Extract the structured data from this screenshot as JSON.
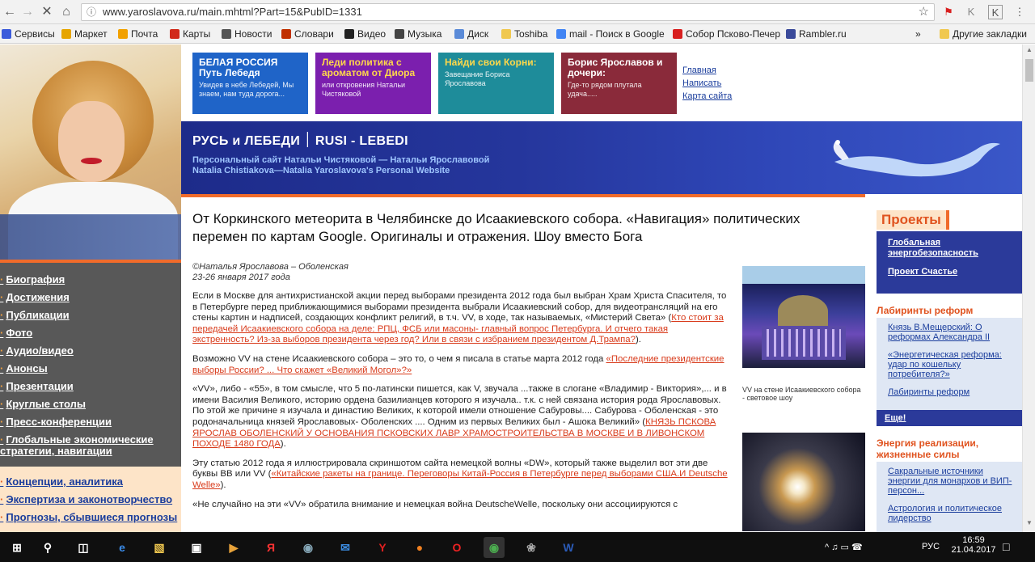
{
  "browser": {
    "url": "www.yaroslavova.ru/main.mhtml?Part=15&PubID=1331",
    "bookmarks": [
      {
        "label": "Сервисы",
        "color": "#3b5bdb"
      },
      {
        "label": "Маркет",
        "color": "#e6a500"
      },
      {
        "label": "Почта",
        "color": "#f2a100"
      },
      {
        "label": "Карты",
        "color": "#d12a1a"
      },
      {
        "label": "Новости",
        "color": "#555555"
      },
      {
        "label": "Словари",
        "color": "#c03000"
      },
      {
        "label": "Видео",
        "color": "#222222"
      },
      {
        "label": "Музыка",
        "color": "#444444"
      },
      {
        "label": "Диск",
        "color": "#5b8bd8"
      },
      {
        "label": "Toshiba",
        "color": "#f0c850"
      },
      {
        "label": "mail - Поиск в Google",
        "color": "#4285f4"
      },
      {
        "label": "Собор Псково-Печер",
        "color": "#d81f1f"
      },
      {
        "label": "Rambler.ru",
        "color": "#3a4a9a"
      }
    ],
    "more_label": "»",
    "other_bookmarks": "Другие закладки"
  },
  "banners": [
    {
      "title": "БЕЛАЯ РОССИЯ",
      "title2": "Путь Лебедя",
      "text": "Увидев в небе Лебедей, Мы знаем, нам туда дорога...",
      "color": "#1f64c8"
    },
    {
      "title": "Леди политика с ароматом от Диора",
      "title2": "",
      "text": "или откровения Натальи Чистяковой",
      "color": "#7b1fae"
    },
    {
      "title": "Найди свои Корни:",
      "title2": "",
      "text": "Завещание Бориса Ярославова",
      "color": "#1e8c9a"
    },
    {
      "title": "Борис Ярославов и дочери:",
      "title2": "",
      "text": "Где-то рядом плутала удача.....",
      "color": "#8a2a3a"
    }
  ],
  "top_links": [
    "Главная",
    "Написать",
    "Карта сайта"
  ],
  "header": {
    "title": "РУСЬ и ЛЕБЕДИ ׀ RUSI - LEBEDI",
    "sub1": "Персональный сайт Натальи Чистяковой — Натальи Ярославовой",
    "sub2": "Natalia Chistiakova—Natalia Yaroslavova's  Personal Website"
  },
  "left_nav": [
    "Биография",
    "Достижения",
    "Публикации",
    "Фото",
    "Аудио/видео",
    "Анонсы",
    "Презентации",
    "Круглые столы",
    "Пресс-конференции",
    "Глобальные экономические стратегии, навигации"
  ],
  "left_nav2": [
    "Концепции, аналитика",
    "Экспертиза и законотворчество",
    "Прогнозы, сбывшиеся прогнозы"
  ],
  "article": {
    "title": "От Коркинского метеорита в Челябинске до Исаакиевского собора. «Навигация» политических перемен по картам Google. Оригиналы и отражения. Шоу вместо Бога",
    "author": "©Наталья Ярославова – Оболенская",
    "date": "23-26 января 2017 года",
    "p1_text": "Если в Москве для антихристианской акции перед выборами президента 2012 года был выбран Храм Христа Спасителя, то в Петербурге перед приближающимися выборами президента выбрали Исаакиевский собор, для видеотрансляций на его стены картин и надписей, создающих конфликт религий, в т.ч. VV, в ходе, так называемых, «Мистерий Света» (",
    "p1_link": "Кто стоит за передачей Исаакиевского собора на деле: РПЦ, ФСБ или масоны- главный вопрос Петербурга. И отчего такая экстренность? Из-за выборов президента через год? Или в связи с избранием президентом Д.Трампа?",
    "p1_end": ").",
    "p2_text": "Возможно VV на стене Исаакиевского собора – это то, о чем я писала в статье марта 2012 года ",
    "p2_link": "«Последние президентские выборы России? ... Что скажет «Великий Могол»?»",
    "p3_text": "«VV», либо - «55», в том смысле, что 5 по-латински пишется, как V, звучала ...также в слогане «Владимир - Виктория»,... и в имени Василия Великого, историю ордена базилианцев которого я изучала.. т.к. с ней связана история рода Ярославовых. По этой же причине я изучала и династию Великих, к которой имели отношение Сабуровы.... Сабурова - Оболенская - это родоначальница князей Ярославовых- Оболенских .... Одним из первых Великих был - Ашока Великий» (",
    "p3_link": "КНЯЗЬ ПСКОВА ЯРОСЛАВ ОБОЛЕНСКИЙ У ОСНОВАНИЯ ПСКОВСКИХ ЛАВР ХРАМОСТРОИТЕЛЬСТВА В МОСКВЕ И В ЛИВОНСКОМ ПОХОДЕ 1480 ГОДА",
    "p3_end": ").",
    "p4_text": "Эту статью 2012 года я иллюстрировала скриншотом сайта немецкой волны «DW», который также выделил вот эти две буквы ВВ или VV (",
    "p4_link": "«Китайские ракеты на границе. Переговоры Китай-Россия в Петербурге перед выборами США.И Deutsche Welle»",
    "p4_end": ").",
    "p5_text": "«Не случайно на эти «VV» обратила внимание и немецкая война DeutscheWelle, поскольку они ассоциируются с",
    "figure_caption": "VV на стене Исаакиевского собора - световое шоу"
  },
  "right": {
    "projects_title": "Проекты",
    "projects": [
      "Глобальная энергобезопасность",
      "Проект Счастье"
    ],
    "reforms_title": "Лабиринты реформ",
    "reforms": [
      "Князь В.Мещерский: О реформах Александра II",
      "«Энергетическая реформа: удар по кошельку потребителя?»",
      "Лабиринты реформ"
    ],
    "more": "Еще!",
    "energy_title": "Энергия реализации, жизненные силы",
    "energy": [
      "Сакральные источники энергии для монархов и ВИП-персон...",
      "Астрология и политическое лидерство"
    ]
  },
  "taskbar": {
    "time": "16:59",
    "date": "21.04.2017",
    "lang": "РУС"
  }
}
